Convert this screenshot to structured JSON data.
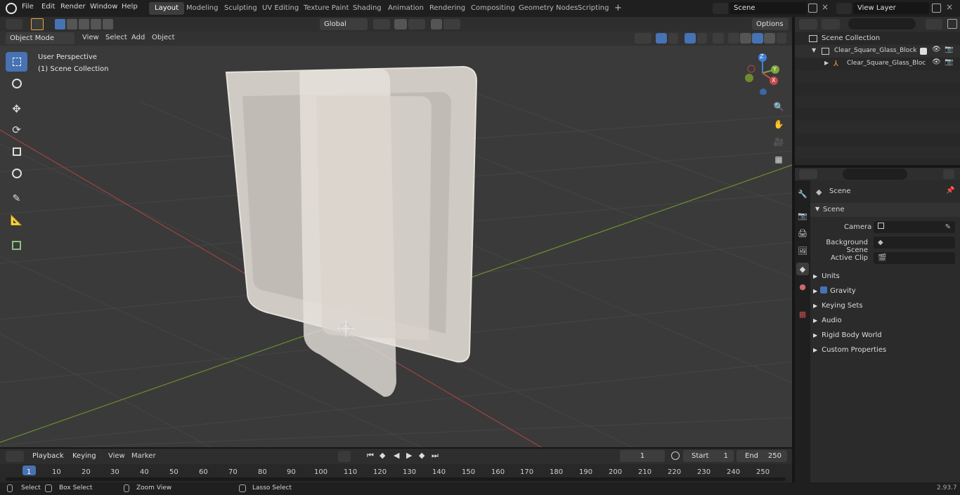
{
  "topbar": {
    "menus": [
      "File",
      "Edit",
      "Render",
      "Window",
      "Help"
    ],
    "workspaces": [
      "Layout",
      "Modeling",
      "Sculpting",
      "UV Editing",
      "Texture Paint",
      "Shading",
      "Animation",
      "Rendering",
      "Compositing",
      "Geometry Nodes",
      "Scripting"
    ],
    "active_workspace": "Layout",
    "add_tab": "+",
    "scene_name": "Scene",
    "view_layer": "View Layer"
  },
  "header": {
    "mode": "Object Mode",
    "menus": [
      "View",
      "Select",
      "Add",
      "Object"
    ],
    "transform_orientation": "Global",
    "options": "Options"
  },
  "viewport": {
    "perspective": "User Perspective",
    "collection": "(1) Scene Collection",
    "gizmo": {
      "z": "Z",
      "y": "Y",
      "x": "X"
    }
  },
  "outliner": {
    "root": "Scene Collection",
    "items": [
      "Clear_Square_Glass_Block",
      "Clear_Square_Glass_Bloc"
    ]
  },
  "properties": {
    "context": "Scene",
    "section": "Scene",
    "camera_label": "Camera",
    "background_label": "Background Scene",
    "clip_label": "Active Clip",
    "panels": [
      "Units",
      "Gravity",
      "Keying Sets",
      "Audio",
      "Rigid Body World",
      "Custom Properties"
    ]
  },
  "timeline": {
    "menus": [
      "Playback",
      "Keying",
      "View",
      "Marker"
    ],
    "current_frame": "1",
    "start_label": "Start",
    "start": "1",
    "end_label": "End",
    "end": "250",
    "ticks": [
      "1",
      "10",
      "20",
      "30",
      "40",
      "50",
      "60",
      "70",
      "80",
      "90",
      "100",
      "110",
      "120",
      "130",
      "140",
      "150",
      "160",
      "170",
      "180",
      "190",
      "200",
      "210",
      "220",
      "230",
      "240",
      "250"
    ]
  },
  "status": {
    "select": "Select",
    "box_select": "Box Select",
    "zoom": "Zoom View",
    "lasso": "Lasso Select",
    "version": "2.93.7"
  },
  "colors": {
    "accent": "#4772b3",
    "x_axis": "#c74a4a",
    "y_axis": "#7ea33a",
    "z_axis": "#3f7fd6"
  }
}
